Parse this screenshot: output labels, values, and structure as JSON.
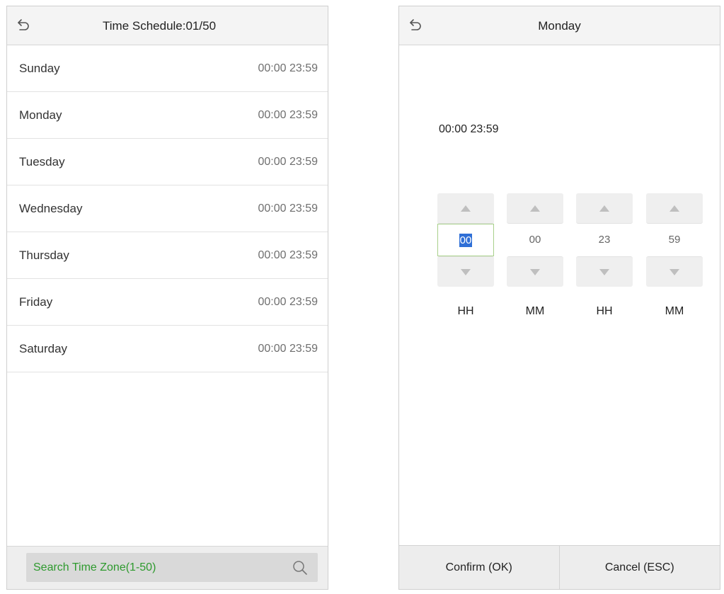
{
  "colors": {
    "search_text": "#2e9a2e",
    "focus_border": "#a8d08a",
    "selection": "#2f6fd6"
  },
  "left_screen": {
    "title": "Time Schedule:01/50",
    "back_icon": "back-arrow-icon",
    "days": [
      {
        "day": "Sunday",
        "range": "00:00 23:59"
      },
      {
        "day": "Monday",
        "range": "00:00 23:59"
      },
      {
        "day": "Tuesday",
        "range": "00:00 23:59"
      },
      {
        "day": "Wednesday",
        "range": "00:00 23:59"
      },
      {
        "day": "Thursday",
        "range": "00:00 23:59"
      },
      {
        "day": "Friday",
        "range": "00:00 23:59"
      },
      {
        "day": "Saturday",
        "range": "00:00 23:59"
      }
    ],
    "search": {
      "placeholder": "Search Time Zone(1-50)",
      "icon": "search-icon"
    }
  },
  "right_screen": {
    "title": "Monday",
    "back_icon": "back-arrow-icon",
    "time_display": "00:00 23:59",
    "spinners": [
      {
        "value": "00",
        "label": "HH",
        "focused": true
      },
      {
        "value": "00",
        "label": "MM",
        "focused": false
      },
      {
        "value": "23",
        "label": "HH",
        "focused": false
      },
      {
        "value": "59",
        "label": "MM",
        "focused": false
      }
    ],
    "confirm_label": "Confirm (OK)",
    "cancel_label": "Cancel (ESC)"
  }
}
